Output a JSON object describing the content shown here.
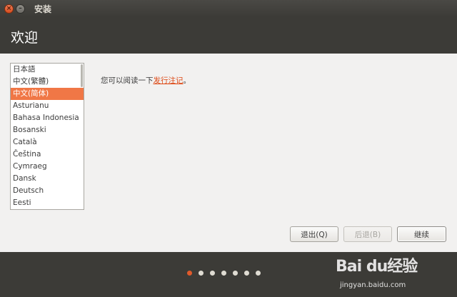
{
  "window": {
    "title": "安装",
    "close_icon": "×",
    "minimize_icon": "–"
  },
  "header": {
    "title": "欢迎"
  },
  "languages": {
    "items": [
      "日本語",
      "中文(繁體)",
      "中文(简体)",
      "Asturianu",
      "Bahasa Indonesia",
      "Bosanski",
      "Català",
      "Čeština",
      "Cymraeg",
      "Dansk",
      "Deutsch",
      "Eesti"
    ],
    "selected": "中文(简体)"
  },
  "notes": {
    "prefix": "您可以阅读一下",
    "link": "发行注记",
    "suffix": "。"
  },
  "buttons": {
    "quit": "退出(Q)",
    "back": "后退(B)",
    "continue": "继续"
  },
  "steps": {
    "total": 7,
    "current": 1
  },
  "watermark": {
    "logo": "Bai du经验",
    "url": "jingyan.baidu.com"
  },
  "colors": {
    "accent": "#f07746",
    "link": "#dd4814",
    "chrome": "#3c3b37",
    "content_bg": "#f2f1f0"
  }
}
